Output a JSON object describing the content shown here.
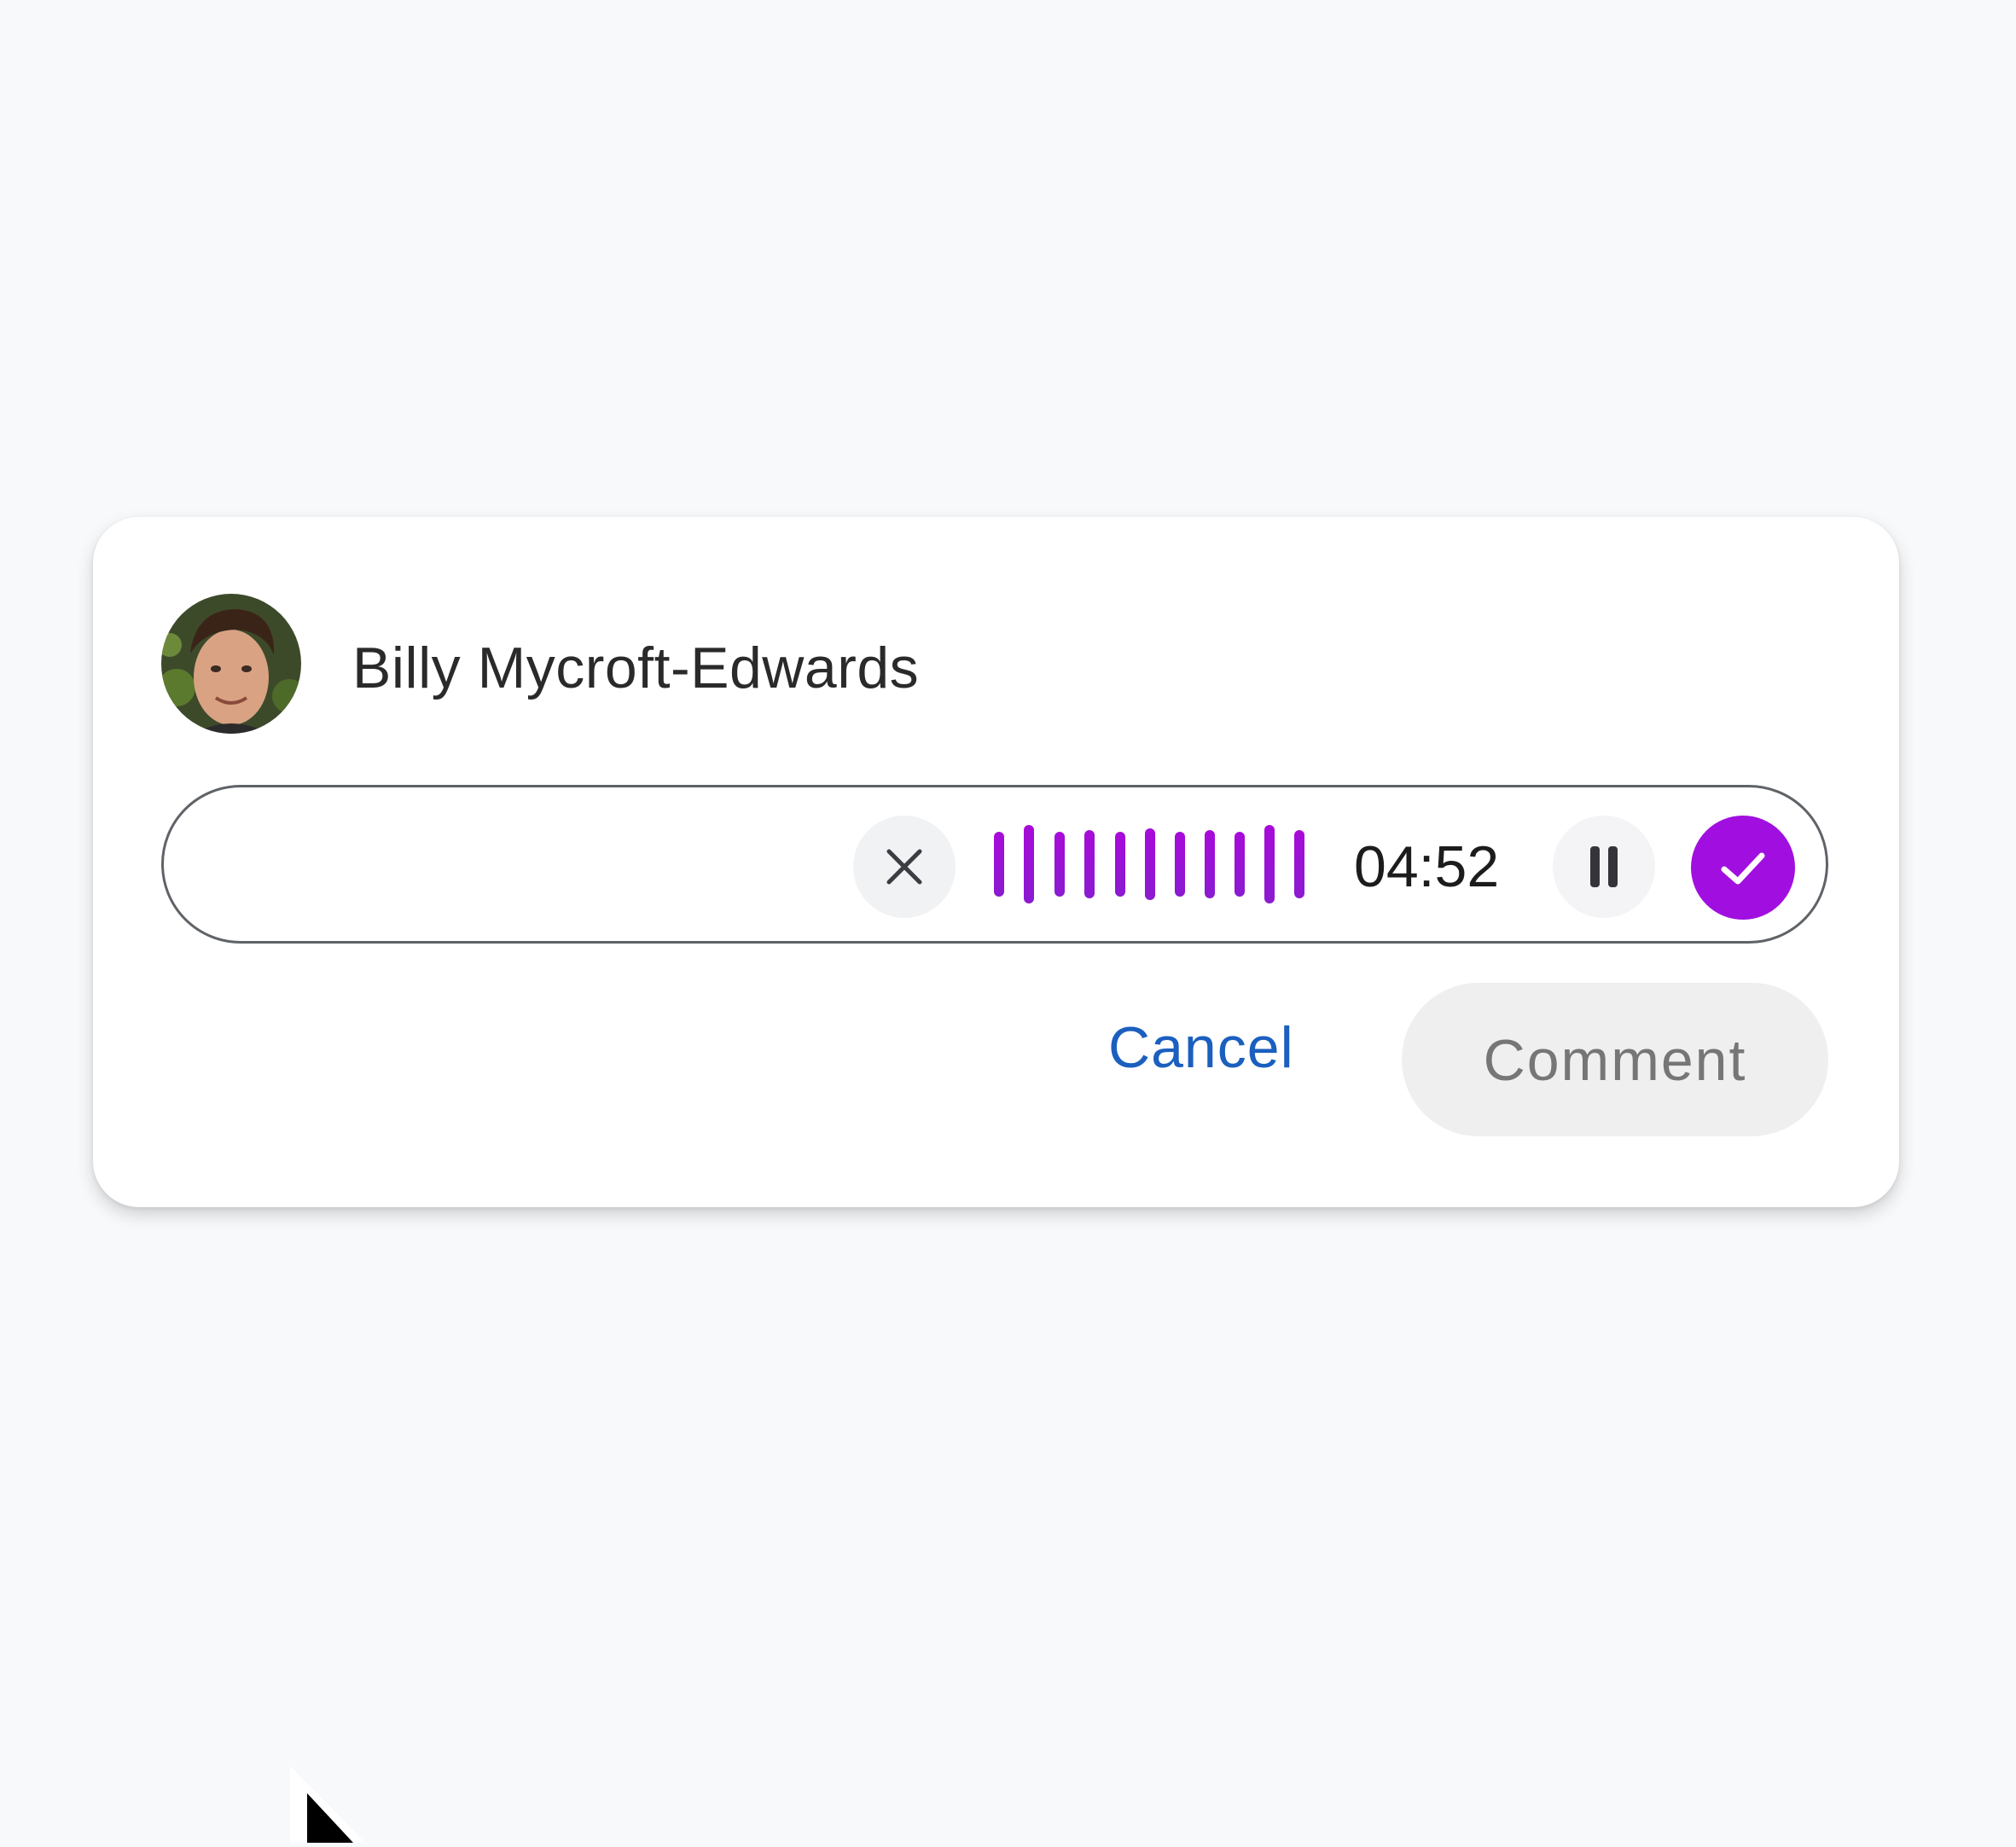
{
  "comment_box": {
    "author_name": "Billy Mycroft-Edwards",
    "avatar_icon": "user-avatar-photo"
  },
  "recorder": {
    "timer": "04:52",
    "discard_icon": "close-icon",
    "waveform_icon": "audio-waveform",
    "pause_icon": "pause-icon",
    "confirm_icon": "check-icon",
    "accent_color": "#a10fe0"
  },
  "actions": {
    "cancel_label": "Cancel",
    "comment_label": "Comment",
    "cancel_color": "#1b5fbf"
  },
  "cursor_icon": "mouse-pointer-icon"
}
